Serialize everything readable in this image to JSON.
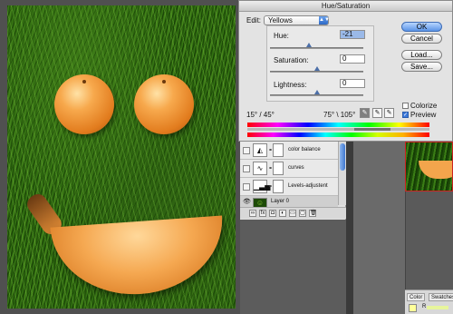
{
  "dialog": {
    "title": "Hue/Saturation",
    "edit_label": "Edit:",
    "edit_value": "Yellows",
    "hue_label": "Hue:",
    "hue_value": "-21",
    "saturation_label": "Saturation:",
    "saturation_value": "0",
    "lightness_label": "Lightness:",
    "lightness_value": "0",
    "range_left": "15° / 45°",
    "range_right": "75° \\ 105°",
    "ok_label": "OK",
    "cancel_label": "Cancel",
    "load_label": "Load...",
    "save_label": "Save...",
    "colorize_label": "Colorize",
    "colorize_checked": false,
    "preview_label": "Preview",
    "preview_checked": true,
    "accent_color": "#3b78d9"
  },
  "layers": {
    "items": [
      {
        "name": "color balance",
        "visible": false,
        "icon": "color-balance-icon"
      },
      {
        "name": "curves",
        "visible": false,
        "icon": "curves-icon"
      },
      {
        "name": "Levels-adjustent",
        "visible": false,
        "icon": "levels-icon"
      },
      {
        "name": "Layer 0",
        "visible": true,
        "icon": "layer-thumbnail"
      }
    ],
    "footer_icons": [
      "link-icon",
      "fx-icon",
      "mask-icon",
      "adjustment-icon",
      "group-icon",
      "new-layer-icon",
      "trash-icon"
    ]
  },
  "color_panel": {
    "tabs": [
      "Color",
      "Swatches"
    ],
    "channel_label": "R",
    "foreground_color": "#ffff99"
  }
}
